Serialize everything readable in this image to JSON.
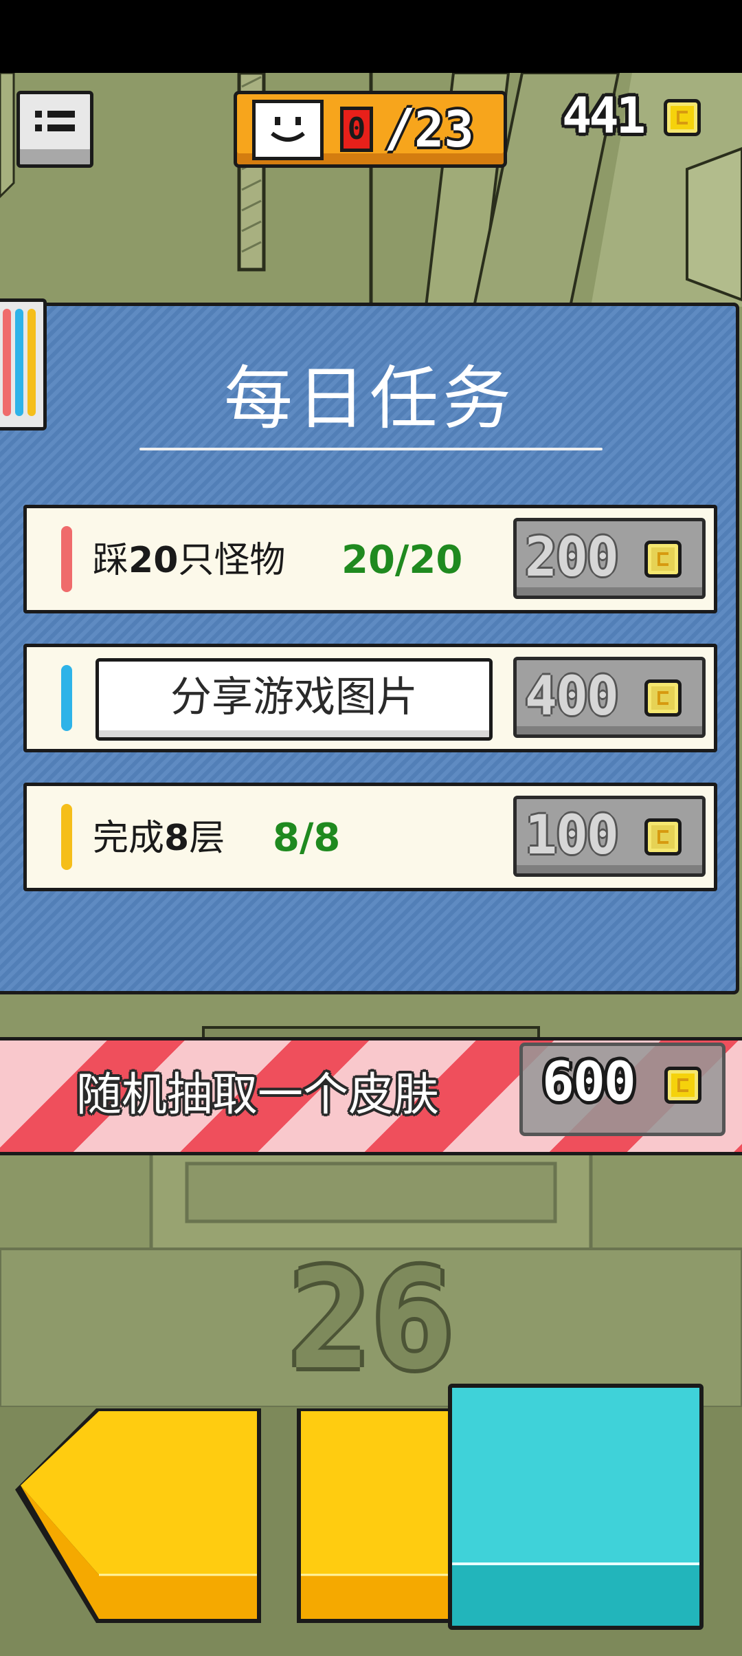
{
  "top_bar": {
    "menu_icon": "menu-list-icon",
    "character_icon": "smiley-face-icon",
    "progress_current": "0",
    "progress_separator": "/",
    "progress_total": "23",
    "coins": "441",
    "coin_icon": "coin-icon"
  },
  "daily_tasks": {
    "title": "每日任务",
    "tasks": [
      {
        "label_pre": "踩",
        "label_num": "20",
        "label_post": "只怪物",
        "progress": "20/20",
        "reward": "200",
        "color": "#ef6b6b"
      },
      {
        "share_label": "分享游戏图片",
        "reward": "400",
        "color": "#2eb3e8"
      },
      {
        "label_pre": "完成",
        "label_num": "8",
        "label_post": "层",
        "progress": "8/8",
        "reward": "100",
        "color": "#f5be1a"
      }
    ],
    "tab_colors": [
      "#ef6b6b",
      "#2eb3e8",
      "#f5be1a"
    ]
  },
  "skin_offer": {
    "label": "随机抽取一个皮肤",
    "price": "600"
  },
  "floor_number": "26",
  "controls": {
    "left_icon": "left-arrow-icon",
    "right_icon": "right-arrow-icon",
    "jump_icon": "jump-block-icon"
  }
}
